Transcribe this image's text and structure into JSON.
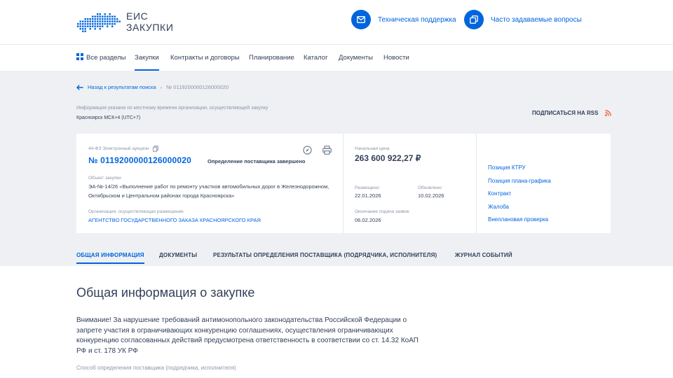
{
  "header": {
    "logo_line1": "ЕИС",
    "logo_line2": "ЗАКУПКИ",
    "support_label": "Техническая поддержка",
    "faq_label": "Часто задаваемые вопросы",
    "accent_color": "#0065dd"
  },
  "nav": {
    "items": [
      "Все разделы",
      "Закупки",
      "Контракты и договоры",
      "Планирование",
      "Каталог",
      "Документы",
      "Новости"
    ],
    "active_index": 1
  },
  "breadcrumb": {
    "back_label": "Назад к результатам поиска",
    "current": "№ 0119200000126000020"
  },
  "timezone": {
    "note": "Информация указана по местному времени организации, осуществляющей закупку",
    "value": "Красноярск МСК+4 (UTC+7)"
  },
  "rss": {
    "label": "ПОДПИСАТЬСЯ НА RSS"
  },
  "card": {
    "type_label": "44-ФЗ Электронный аукцион",
    "reg_number": "№ 0119200000126000020",
    "status": "Определение поставщика завершено",
    "object_label": "Объект закупки",
    "object_text": "ЭА-№-14/26 «Выполнение работ по ремонту участков автомобильных дорог в Железнодорожном, Октябрьском и Центральном районах города Красноярска»",
    "org_label": "Организация, осуществляющая размещение",
    "org_name": "АГЕНТСТВО ГОСУДАРСТВЕННОГО ЗАКАЗА КРАСНОЯРСКОГО КРАЯ",
    "price_label": "Начальная цена",
    "price": "263 600 922,27 ₽",
    "placed_label": "Размещено",
    "placed_date": "22.01.2026",
    "updated_label": "Обновлено",
    "updated_date": "10.02.2026",
    "deadline_label": "Окончание подачи заявок",
    "deadline_date": "06.02.2026",
    "links": [
      "Позиция КТРУ",
      "Позиция плана-графика",
      "Контракт",
      "Жалоба",
      "Внеплановая проверка"
    ]
  },
  "tabs": {
    "items": [
      "ОБЩАЯ ИНФОРМАЦИЯ",
      "ДОКУМЕНТЫ",
      "РЕЗУЛЬТАТЫ ОПРЕДЕЛЕНИЯ ПОСТАВЩИКА (ПОДРЯДЧИКА, ИСПОЛНИТЕЛЯ)",
      "ЖУРНАЛ СОБЫТИЙ"
    ],
    "active_index": 0
  },
  "main": {
    "title": "Общая информация о закупке",
    "warning": "Внимание! За нарушение требований антимонопольного законодательства Российской Федерации о запрете участия в ограничивающих конкуренцию соглашениях, осуществления ограничивающих конкуренцию согласованных действий предусмотрена ответственность в соответствии со ст. 14.32 КоАП РФ и ст. 178 УК РФ",
    "method_label": "Способ определения поставщика (подрядчика, исполнителя)"
  }
}
